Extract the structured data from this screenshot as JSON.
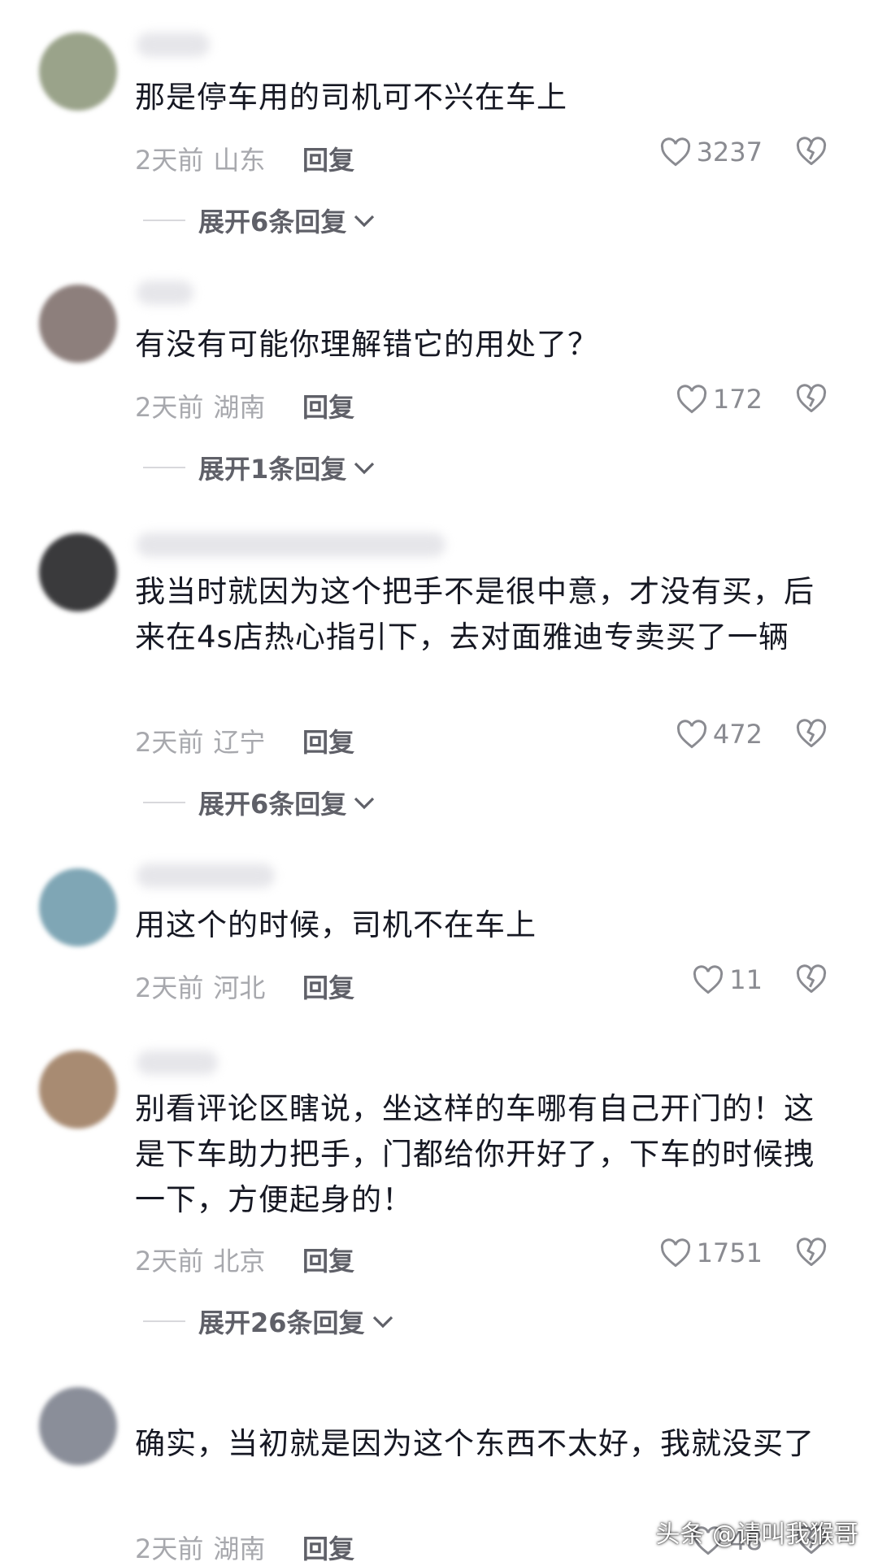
{
  "comments": [
    {
      "text": "那是停车用的司机可不兴在车上",
      "time": "2天前",
      "location": "山东",
      "reply_label": "回复",
      "likes": "3237",
      "expand_label": "展开6条回复",
      "avatar_color": "#9aa38a"
    },
    {
      "text": "有没有可能你理解错它的用处了？",
      "time": "2天前",
      "location": "湖南",
      "reply_label": "回复",
      "likes": "172",
      "expand_label": "展开1条回复",
      "avatar_color": "#8d7f7c"
    },
    {
      "text": "我当时就因为这个把手不是很中意，才没有买，后来在4s店热心指引下，去对面雅迪专卖买了一辆",
      "time": "2天前",
      "location": "辽宁",
      "reply_label": "回复",
      "likes": "472",
      "expand_label": "展开6条回复",
      "avatar_color": "#3a3a3c"
    },
    {
      "text": "用这个的时候，司机不在车上",
      "time": "2天前",
      "location": "河北",
      "reply_label": "回复",
      "likes": "11",
      "avatar_color": "#7fa6b5"
    },
    {
      "text": "别看评论区瞎说，坐这样的车哪有自己开门的！这是下车助力把手，门都给你开好了，下车的时候拽一下，方便起身的！",
      "time": "2天前",
      "location": "北京",
      "reply_label": "回复",
      "likes": "1751",
      "expand_label": "展开26条回复",
      "avatar_color": "#a88b72"
    },
    {
      "text": "确实，当初就是因为这个东西不太好，我就没买了",
      "time": "2天前",
      "location": "湖南",
      "reply_label": "回复",
      "likes": "48",
      "avatar_color": "#8a8e99"
    }
  ],
  "watermark": "头条 @请叫我猴哥",
  "colors": {
    "text": "#161823",
    "meta": "#a7a8ad",
    "action": "#5f6068"
  },
  "icons": {
    "like": "heart-outline-icon",
    "dislike": "broken-heart-icon",
    "expand": "chevron-down-icon"
  }
}
